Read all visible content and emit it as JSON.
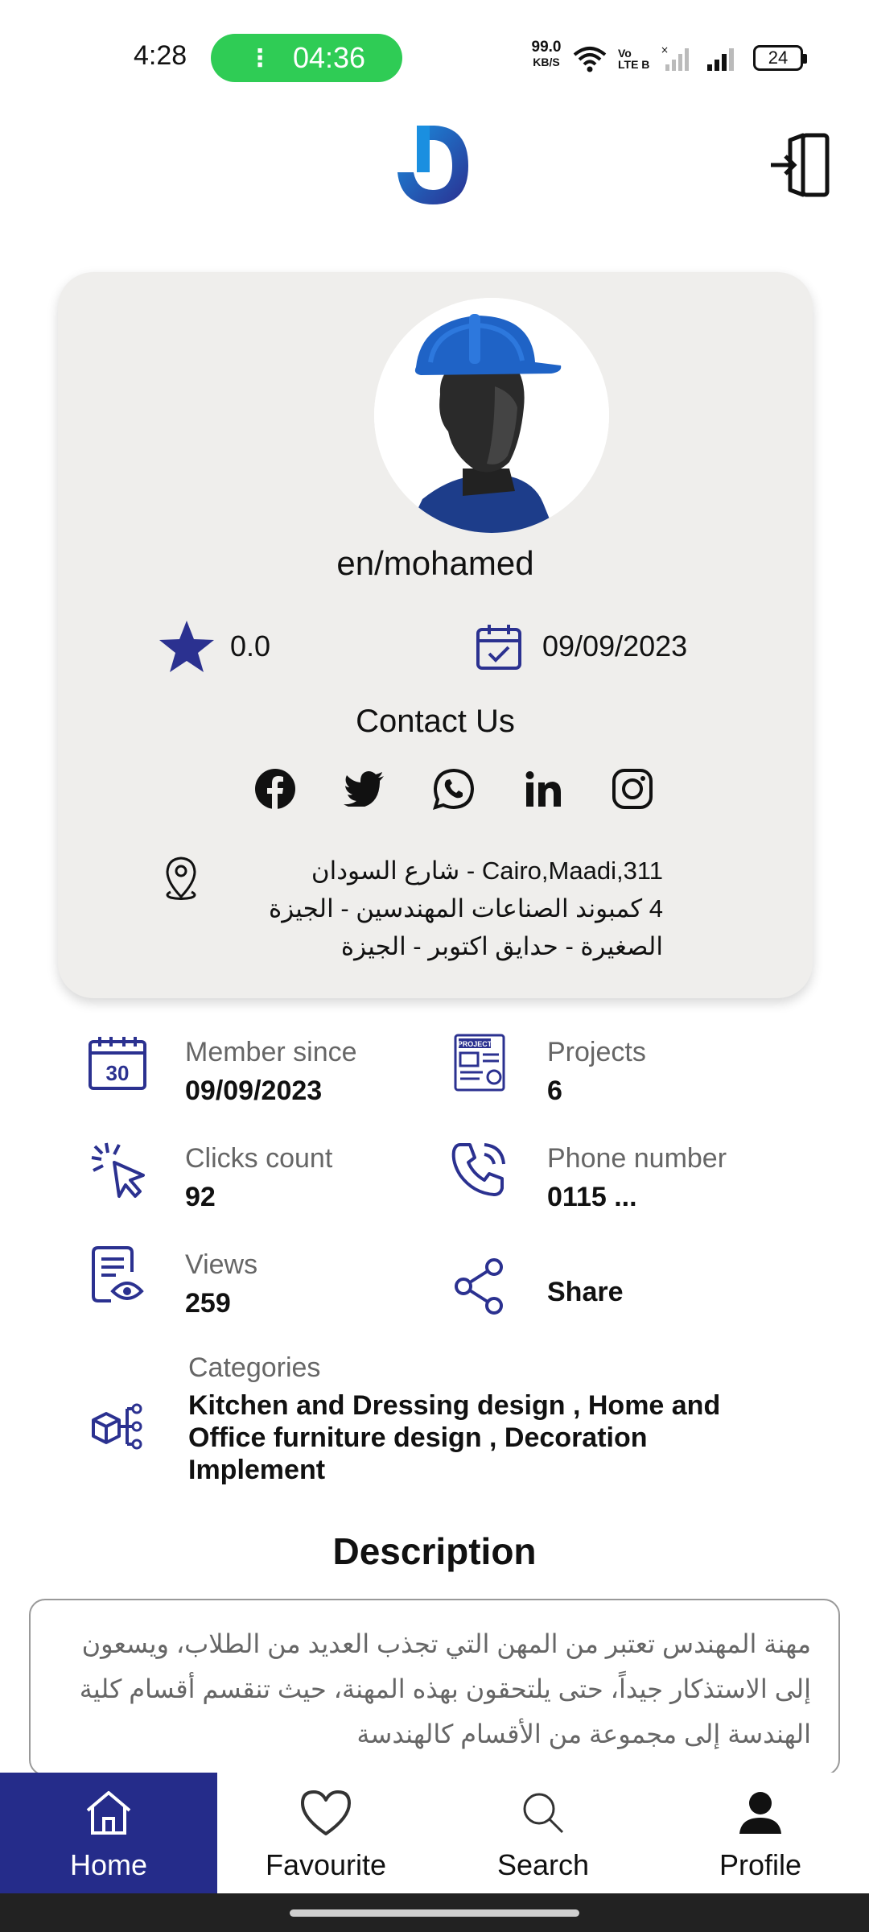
{
  "status_bar": {
    "time": "4:28",
    "call_timer": "04:36",
    "call_indicator": "⋮",
    "net_speed_value": "99.0",
    "net_speed_unit": "KB/S",
    "volte_top": "Vo",
    "volte_bottom": "LTE B",
    "battery": "24",
    "call_color": "#2fcc55"
  },
  "header": {
    "logo_icon": "brand-logo",
    "logout_icon": "logout-icon"
  },
  "profile": {
    "username": "en/mohamed",
    "rating": "0.0",
    "join_date": "09/09/2023",
    "contact_title": "Contact Us",
    "socials": [
      "facebook",
      "twitter",
      "whatsapp",
      "linkedin",
      "instagram"
    ],
    "address_lines": [
      "Cairo,Maadi,311 - شارع السودان",
      "4 كمبوند الصناعات المهندسين - الجيزة",
      "الصغيرة - حدايق اكتوبر - الجيزة"
    ]
  },
  "info": {
    "member_since": {
      "label": "Member since",
      "value": "09/09/2023",
      "icon": "calendar-30-icon"
    },
    "projects": {
      "label": "Projects",
      "value": "6",
      "icon": "project-icon"
    },
    "clicks": {
      "label": "Clicks count",
      "value": "92",
      "icon": "click-cursor-icon"
    },
    "phone": {
      "label": "Phone number",
      "value": "0115 ...",
      "icon": "phone-ringing-icon"
    },
    "views": {
      "label": "Views",
      "value": "259",
      "icon": "document-eye-icon"
    },
    "share": {
      "label": "Share",
      "icon": "share-icon"
    },
    "categories": {
      "label": "Categories",
      "value": "Kitchen and Dressing design , Home and Office furniture design , Decoration Implement",
      "icon": "categories-tree-icon"
    }
  },
  "description": {
    "title": "Description",
    "text": "مهنة المهندس تعتبر من المهن التي تجذب العديد من الطلاب، ويسعون إلى الاستذكار جيداً، حتى يلتحقون بهذه المهنة، حيث تنقسم أقسام كلية الهندسة إلى مجموعة من الأقسام كالهندسة"
  },
  "nav": {
    "items": [
      {
        "label": "Home",
        "icon": "home-icon"
      },
      {
        "label": "Favourite",
        "icon": "heart-icon"
      },
      {
        "label": "Search",
        "icon": "search-icon"
      },
      {
        "label": "Profile",
        "icon": "person-icon"
      }
    ],
    "active_index": 0,
    "active_color": "#252c8a"
  },
  "colors": {
    "accent": "#2b3190",
    "card_bg": "#efeeec"
  }
}
